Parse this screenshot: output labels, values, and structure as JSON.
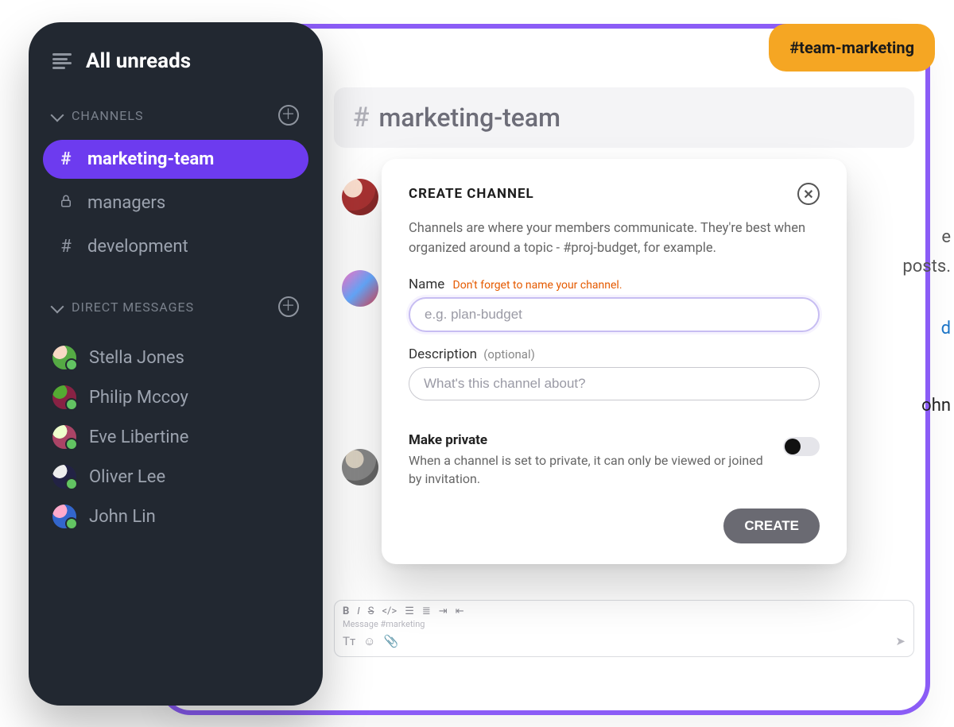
{
  "colors": {
    "accent": "#6D3BEF",
    "frame": "#8B5CF6",
    "tag_bg": "#F5A623",
    "sidebar_bg": "#222831"
  },
  "tag": {
    "label": "#team-marketing"
  },
  "main": {
    "channel_hash": "#",
    "channel_title": "marketing-team",
    "bg_text_line1_suffix": "e",
    "bg_text_line2": "posts.",
    "bg_link_fragment": "d",
    "bg_name_fragment": "ohn"
  },
  "compose": {
    "placeholder": "Message #marketing",
    "format_icons": [
      "B",
      "I",
      "S",
      "</>",
      "list-icon",
      "numlist-icon",
      "indent-icon",
      "outdent-icon"
    ],
    "bottom_icons": [
      "Tт",
      "☺",
      "📎"
    ],
    "send_icon": "➤"
  },
  "sidebar": {
    "top_title": "All unreads",
    "sections": {
      "channels": {
        "label": "CHANNELS"
      },
      "dms": {
        "label": "DIRECT MESSAGES"
      }
    },
    "channels": [
      {
        "icon": "#",
        "label": "marketing-team",
        "active": true
      },
      {
        "icon": "lock",
        "label": "managers",
        "active": false
      },
      {
        "icon": "#",
        "label": "development",
        "active": false
      }
    ],
    "dms": [
      {
        "name": "Stella Jones"
      },
      {
        "name": "Philip Mccoy"
      },
      {
        "name": "Eve Libertine"
      },
      {
        "name": "Oliver Lee"
      },
      {
        "name": "John Lin"
      }
    ]
  },
  "modal": {
    "title": "CREATE CHANNEL",
    "description": "Channels are where your members communicate. They're best when organized around a topic - #proj-budget, for example.",
    "name_label": "Name",
    "name_hint": "Don't forget to name your channel.",
    "name_placeholder": "e.g. plan-budget",
    "desc_label": "Description",
    "desc_optional": "(optional)",
    "desc_placeholder": "What's this channel about?",
    "private_title": "Make private",
    "private_desc": "When a channel is set to private, it can only be viewed or joined by invitation.",
    "create_button": "CREATE"
  }
}
